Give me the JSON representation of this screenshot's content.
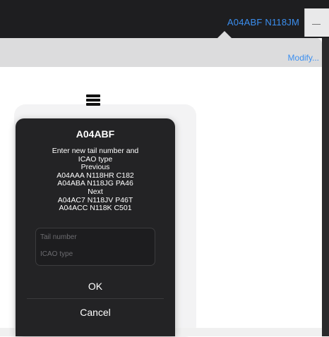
{
  "header": {
    "tail_info": "A04ABF  N118JM"
  },
  "toolbar": {
    "modify_label": "Modify..."
  },
  "dialog": {
    "title": "A04ABF",
    "message_lines": [
      "Enter new tail number and",
      "ICAO type",
      "Previous",
      "A04AAA N118HR C182",
      "A04ABA N118JG PA46",
      "Next",
      "A04AC7 N118JV P46T",
      "A04ACC N118K C501"
    ],
    "tail_placeholder": "Tail number",
    "icao_placeholder": "ICAO type",
    "ok_label": "OK",
    "cancel_label": "Cancel"
  },
  "colors": {
    "accent": "#3b8ff0",
    "dialog_bg": "#232325",
    "topbar_bg": "#1e1e20"
  }
}
